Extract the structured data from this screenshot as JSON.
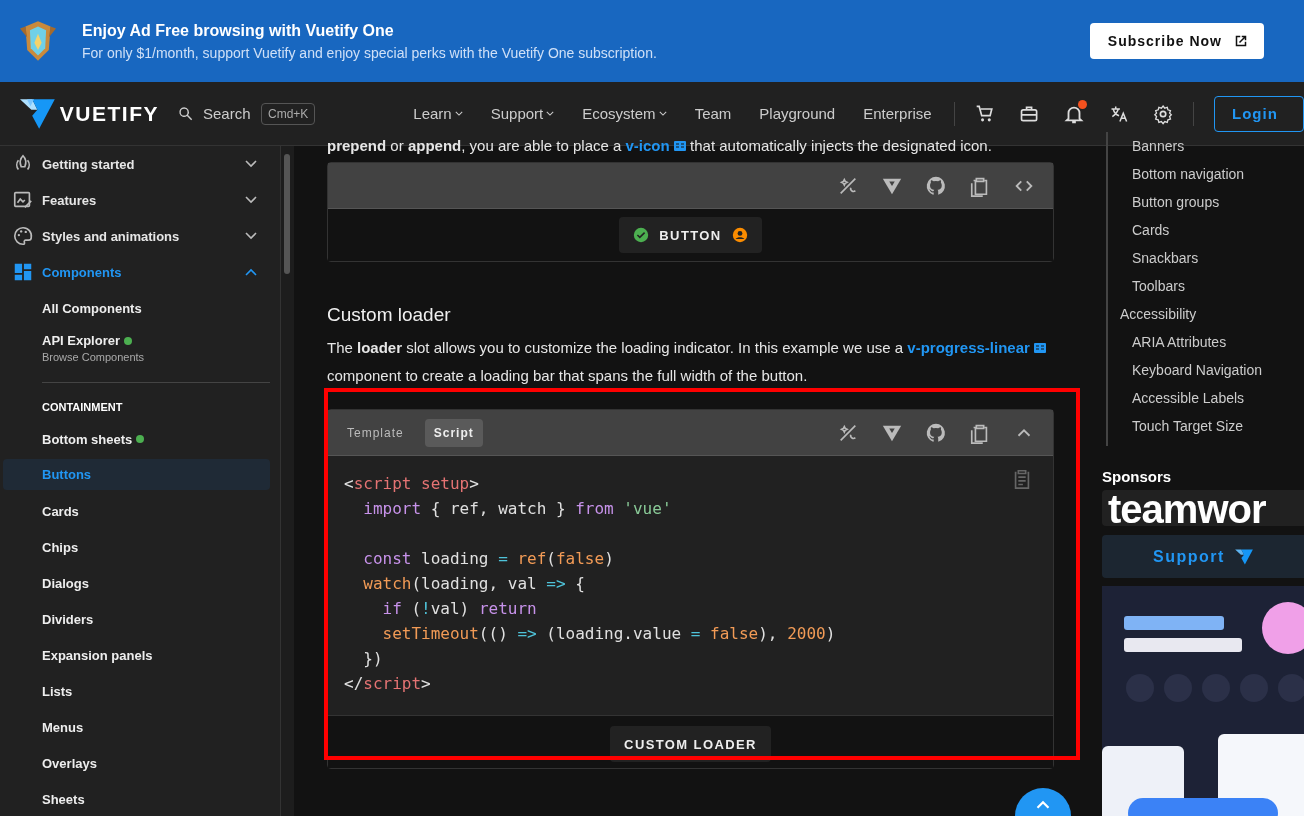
{
  "banner": {
    "title": "Enjoy Ad Free browsing with Vuetify One",
    "subtitle": "For only $1/month, support Vuetify and enjoy special perks with the Vuetify One subscription.",
    "button": "Subscribe Now"
  },
  "nav": {
    "logo": "VUETIFY",
    "search": {
      "placeholder": "Search",
      "shortcut": "Cmd+K"
    },
    "links": [
      {
        "label": "Learn",
        "dropdown": true
      },
      {
        "label": "Support",
        "dropdown": true
      },
      {
        "label": "Ecosystem",
        "dropdown": true
      },
      {
        "label": "Team",
        "dropdown": false
      },
      {
        "label": "Playground",
        "dropdown": false
      },
      {
        "label": "Enterprise",
        "dropdown": false
      }
    ],
    "notification_dot": true,
    "login": "Login"
  },
  "sidebar": {
    "groups": [
      {
        "label": "Getting started",
        "expanded": false
      },
      {
        "label": "Features",
        "expanded": false
      },
      {
        "label": "Styles and animations",
        "expanded": false
      },
      {
        "label": "Components",
        "expanded": true
      }
    ],
    "components": [
      {
        "label": "All Components",
        "badge": false
      },
      {
        "label": "API Explorer",
        "badge": true,
        "subtitle": "Browse Components"
      }
    ],
    "section": {
      "title": "CONTAINMENT",
      "items": [
        {
          "label": "Bottom sheets",
          "badge": true,
          "selected": false
        },
        {
          "label": "Buttons",
          "badge": false,
          "selected": true
        },
        {
          "label": "Cards",
          "badge": false,
          "selected": false
        },
        {
          "label": "Chips",
          "badge": false,
          "selected": false
        },
        {
          "label": "Dialogs",
          "badge": false,
          "selected": false
        },
        {
          "label": "Dividers",
          "badge": false,
          "selected": false
        },
        {
          "label": "Expansion panels",
          "badge": false,
          "selected": false
        },
        {
          "label": "Lists",
          "badge": false,
          "selected": false
        },
        {
          "label": "Menus",
          "badge": false,
          "selected": false
        },
        {
          "label": "Overlays",
          "badge": false,
          "selected": false
        },
        {
          "label": "Sheets",
          "badge": false,
          "selected": false
        }
      ]
    }
  },
  "main": {
    "intro": {
      "before": "**prepend** or **append**, you are able to place a ",
      "link": "v-icon",
      "after": " that automatically injects the designated icon."
    },
    "example": {
      "expanded": false,
      "button": "BUTTON"
    },
    "heading": "Custom loader",
    "paragraph": {
      "before": "The **loader** slot allows you to customize the loading indicator. In this example we use a ",
      "link": "v-progress-linear",
      "after": " component to create a loading bar that spans the full width of the button."
    },
    "code_example": {
      "expanded": true,
      "tabs": [
        {
          "label": "Template",
          "selected": false
        },
        {
          "label": "Script",
          "selected": true
        }
      ],
      "code": [
        {
          "gap_after": false,
          "tokens": [
            {
              "text": "<",
              "kind": "plain"
            },
            {
              "text": "script setup",
              "kind": "tag"
            },
            {
              "text": ">",
              "kind": "plain"
            }
          ]
        },
        {
          "gap_after": true,
          "tokens": [
            {
              "text": "  import",
              "kind": "keyword"
            },
            {
              "text": " { ref, watch } ",
              "kind": "plain"
            },
            {
              "text": "from",
              "kind": "keyword"
            },
            {
              "text": " 'vue'",
              "kind": "string"
            }
          ]
        },
        {
          "gap_after": false,
          "tokens": [
            {
              "text": "  const",
              "kind": "keyword"
            },
            {
              "text": " loading ",
              "kind": "plain"
            },
            {
              "text": "= ",
              "kind": "operator"
            },
            {
              "text": "ref",
              "kind": "function"
            },
            {
              "text": "(",
              "kind": "plain"
            },
            {
              "text": "false",
              "kind": "function"
            },
            {
              "text": ")",
              "kind": "plain"
            }
          ]
        },
        {
          "gap_after": false,
          "tokens": [
            {
              "text": "  watch",
              "kind": "function"
            },
            {
              "text": "(loading, val ",
              "kind": "plain"
            },
            {
              "text": "=>",
              "kind": "operator"
            },
            {
              "text": " {",
              "kind": "plain"
            }
          ]
        },
        {
          "gap_after": false,
          "tokens": [
            {
              "text": "    if",
              "kind": "keyword"
            },
            {
              "text": " (",
              "kind": "plain"
            },
            {
              "text": "!",
              "kind": "operator"
            },
            {
              "text": "val) ",
              "kind": "plain"
            },
            {
              "text": "return",
              "kind": "keyword"
            }
          ]
        },
        {
          "gap_after": false,
          "tokens": [
            {
              "text": "    setTimeout",
              "kind": "function"
            },
            {
              "text": "(() ",
              "kind": "plain"
            },
            {
              "text": "=>",
              "kind": "operator"
            },
            {
              "text": " (loading.value ",
              "kind": "plain"
            },
            {
              "text": "= ",
              "kind": "operator"
            },
            {
              "text": "false",
              "kind": "function"
            },
            {
              "text": "), ",
              "kind": "plain"
            },
            {
              "text": "2000",
              "kind": "function"
            },
            {
              "text": ")",
              "kind": "plain"
            }
          ]
        },
        {
          "gap_after": false,
          "tokens": [
            {
              "text": "  })",
              "kind": "plain"
            }
          ]
        },
        {
          "gap_after": false,
          "tokens": [
            {
              "text": "</",
              "kind": "plain"
            },
            {
              "text": "script",
              "kind": "tag"
            },
            {
              "text": ">",
              "kind": "plain"
            }
          ]
        }
      ],
      "button": "CUSTOM LOADER"
    }
  },
  "toc": [
    {
      "children": [
        {
          "label": "Banners"
        },
        {
          "label": "Bottom navigation"
        },
        {
          "label": "Button groups"
        },
        {
          "label": "Cards"
        },
        {
          "label": "Snackbars"
        },
        {
          "label": "Toolbars"
        }
      ]
    },
    {
      "label": "Accessibility",
      "children": [
        {
          "label": "ARIA Attributes"
        },
        {
          "label": "Keyboard Navigation"
        },
        {
          "label": "Accessible Labels"
        },
        {
          "label": "Touch Target Size"
        }
      ]
    }
  ],
  "sponsors": {
    "title": "Sponsors",
    "logo": "teamwor",
    "support": "Support"
  }
}
